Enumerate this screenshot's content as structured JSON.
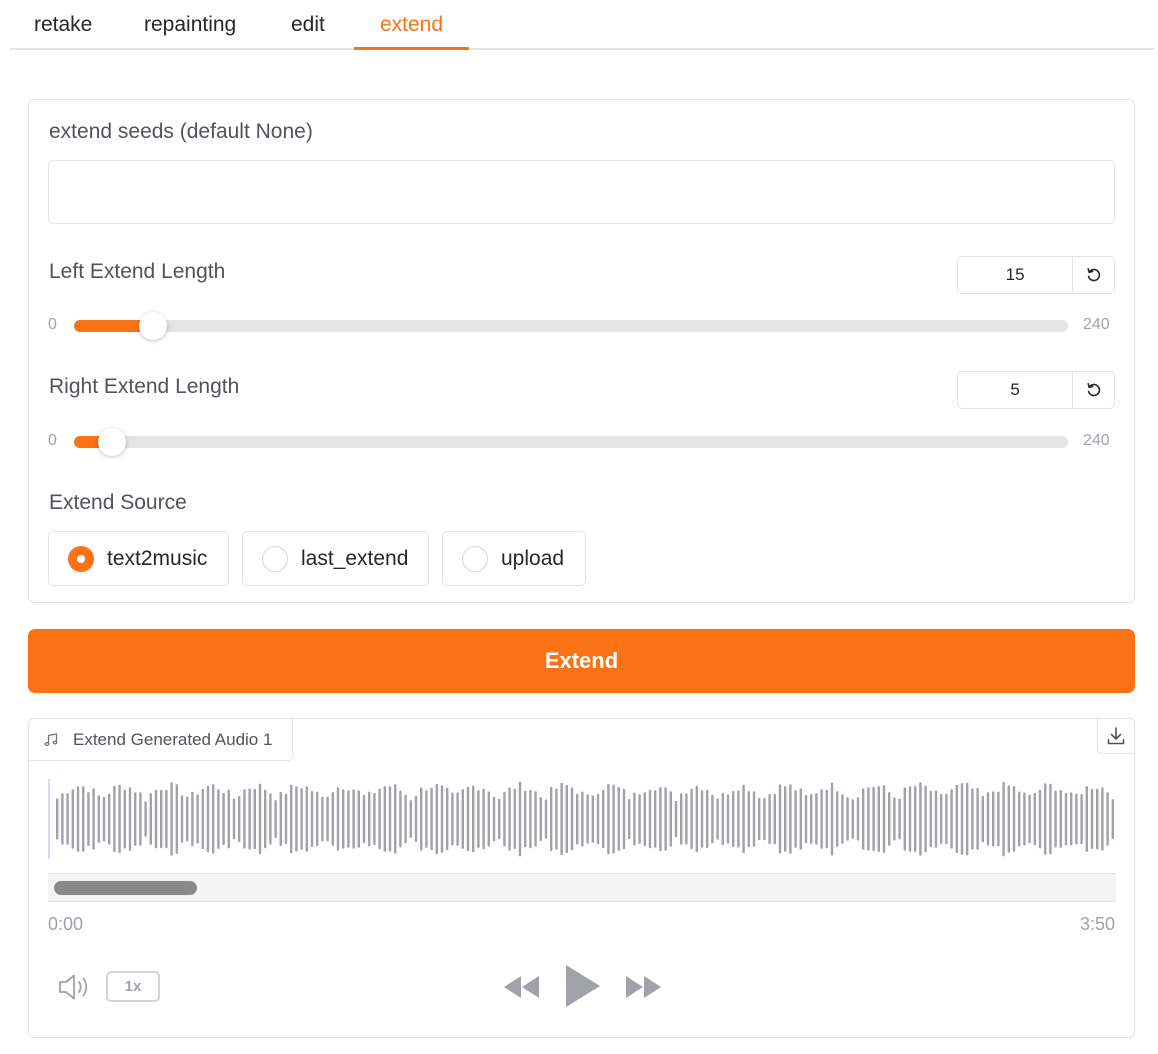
{
  "tabs": [
    {
      "label": "retake"
    },
    {
      "label": "repainting"
    },
    {
      "label": "edit"
    },
    {
      "label": "extend"
    }
  ],
  "active_tab": "extend",
  "seeds": {
    "label": "extend seeds (default None)",
    "value": "",
    "placeholder": ""
  },
  "left_extend": {
    "label": "Left Extend Length",
    "value": "15",
    "min": "0",
    "max": "240"
  },
  "right_extend": {
    "label": "Right Extend Length",
    "value": "5",
    "min": "0",
    "max": "240"
  },
  "extend_source": {
    "label": "Extend Source",
    "options": [
      "text2music",
      "last_extend",
      "upload"
    ],
    "selected": "text2music"
  },
  "extend_button": "Extend",
  "audio": {
    "label": "Extend Generated Audio 1",
    "time_start": "0:00",
    "time_end": "3:50",
    "playback_rate": "1x"
  },
  "colors": {
    "accent": "#f97316",
    "waveform": "#a1a1aa",
    "cursor": "#ddd6fe"
  },
  "icons": {
    "reset": "reset-icon",
    "note": "music-note-icon",
    "download": "download-icon",
    "volume": "volume-icon",
    "rewind": "rewind-icon",
    "play": "play-icon",
    "forward": "fast-forward-icon"
  }
}
